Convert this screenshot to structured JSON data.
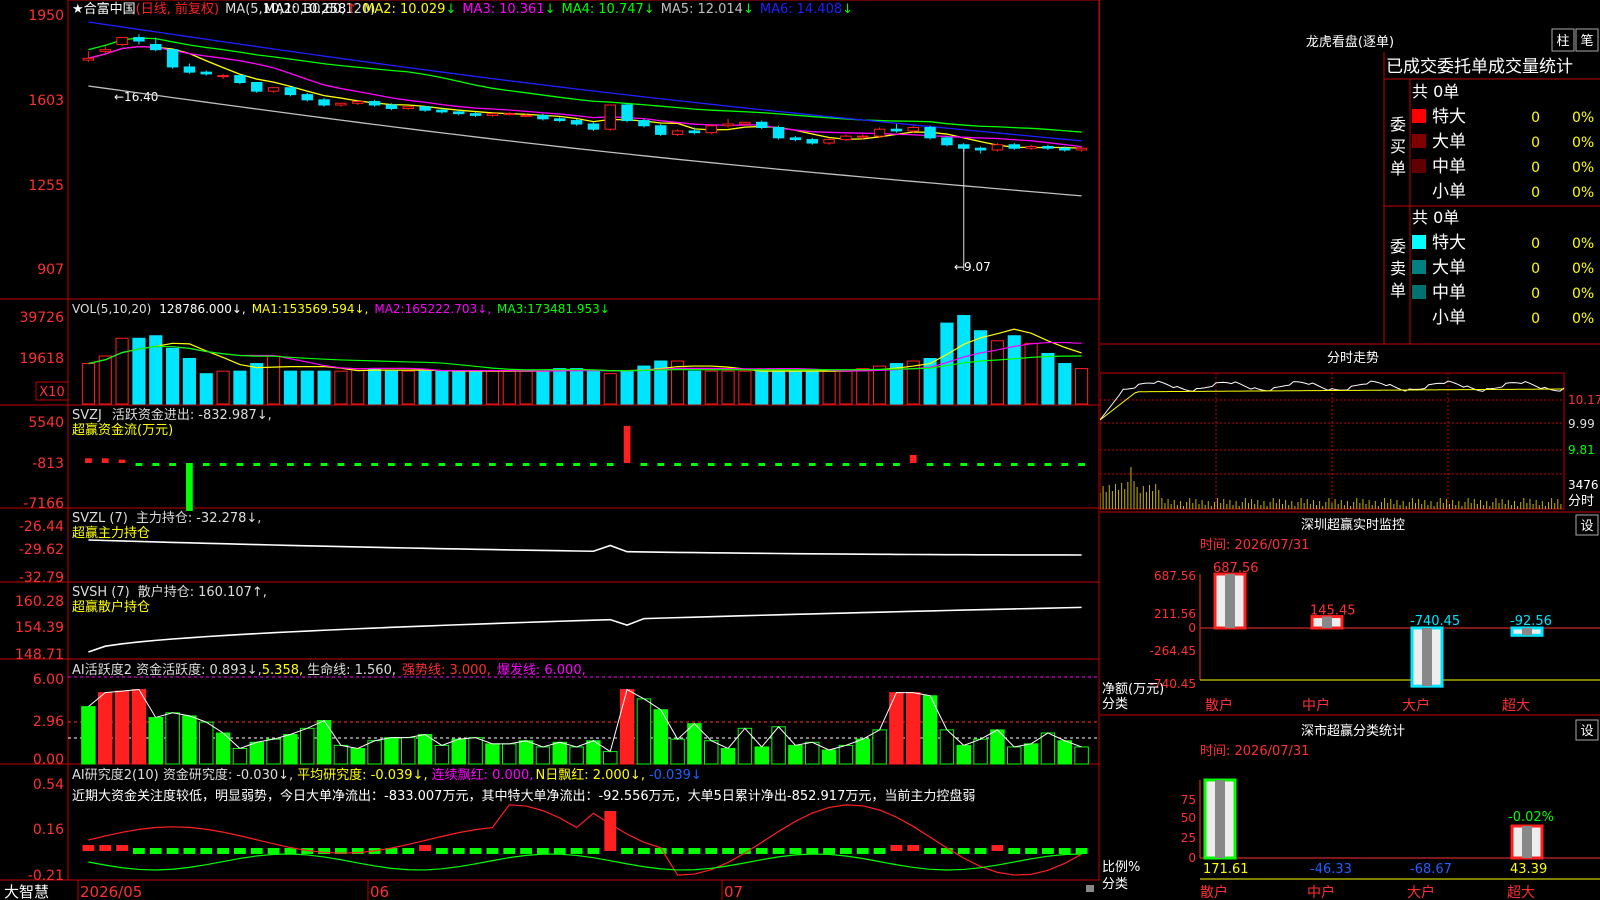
{
  "app": {
    "brand": "大智慧"
  },
  "colors": {
    "up": "#ff2020",
    "down": "#00e5ff",
    "grid": "#c00000",
    "ma1": "#ffffff",
    "ma2": "#ffff00",
    "ma3": "#ff00ff",
    "ma4": "#00ff00",
    "ma5": "#c0c0c0",
    "ma6": "#2020ff",
    "green": "#00ff00",
    "axis": "#ff3030"
  },
  "kline": {
    "star": "★",
    "stock_name": "合富中国",
    "mode": "(日线, 前复权)",
    "ma_label": "MA(5,10,20,30,60,120)",
    "ma": [
      {
        "name": "MA1:",
        "value": "10.258",
        "arrow": "↑"
      },
      {
        "name": "MA2:",
        "value": "10.029",
        "arrow": "↓"
      },
      {
        "name": "MA3:",
        "value": "10.361",
        "arrow": "↓"
      },
      {
        "name": "MA4:",
        "value": "10.747",
        "arrow": "↓"
      },
      {
        "name": "MA5:",
        "value": "12.014",
        "arrow": "↓"
      },
      {
        "name": "MA6:",
        "value": "14.408",
        "arrow": "↓"
      }
    ],
    "yticks": [
      "1950",
      "1603",
      "1255",
      "907"
    ],
    "high_label": "←16.40",
    "low_label": "←9.07"
  },
  "vol": {
    "label": "VOL(5,10,20)",
    "value": "128786.000↓,",
    "ma": [
      {
        "name": "MA1:",
        "value": "153569.594↓,"
      },
      {
        "name": "MA2:",
        "value": "165222.703↓,"
      },
      {
        "name": "MA3:",
        "value": "173481.953↓"
      }
    ],
    "yticks": [
      "39726",
      "19618"
    ],
    "unit": "X10"
  },
  "svzj": {
    "name": "SVZJ",
    "label": "活跃资金进出:",
    "value": "-832.987↓,",
    "sub": "超赢资金流(万元)",
    "yticks": [
      "5540",
      "-813",
      "-7166"
    ]
  },
  "svzl": {
    "name": "SVZL (7)",
    "label": "主力持仓:",
    "value": "-32.278↓,",
    "sub": "超赢主力持仓",
    "yticks": [
      "-26.44",
      "-29.62",
      "-32.79"
    ]
  },
  "svsh": {
    "name": "SVSH (7)",
    "label": "散户持仓:",
    "value": "160.107↑,",
    "sub": "超赢散户持仓",
    "yticks": [
      "160.28",
      "154.39",
      "148.71"
    ]
  },
  "ai_active": {
    "label": "AI活跃度2 资金活跃度:",
    "v1": "0.893↓,",
    "v2": "5.358,",
    "life": "生命线: 1.560,",
    "strong": "强势线: 3.000,",
    "burst": "爆发线: 6.000,",
    "yticks": [
      "6.00",
      "2.96",
      "0.00"
    ]
  },
  "ai_research": {
    "label": "AI研究度2(10) 资金研究度:",
    "v1": "-0.030↓,",
    "avg": "平均研究度: -0.039↓,",
    "red": "连续飘红: 0.000,",
    "nred": "N日飘红: 2.000↓,",
    "v2": "-0.039↓",
    "note": "近期大资金关注度较低，明显弱势，今日大单净流出：-833.007万元，其中特大单净流出：-92.556万元，大单5日累计净出-852.917万元，当前主力控盘弱",
    "yticks": [
      "0.54",
      "0.16",
      "-0.21"
    ]
  },
  "xaxis": [
    "2026/05",
    "06",
    "07"
  ],
  "right": {
    "lhb_title": "龙虎看盘(逐单)",
    "btn_bar": "柱",
    "btn_pen": "笔",
    "stat_title": "已成交委托单成交量统计",
    "buy_side": "委买单",
    "sell_side": "委卖单",
    "buy_total": "共 0单",
    "sell_total": "共 0单",
    "buy_rows": [
      {
        "label": "特大",
        "num": "0",
        "pct": "0%",
        "color": "#ff0000"
      },
      {
        "label": "大单",
        "num": "0",
        "pct": "0%",
        "color": "#800000"
      },
      {
        "label": "中单",
        "num": "0",
        "pct": "0%",
        "color": "#600000"
      },
      {
        "label": "小单",
        "num": "0",
        "pct": "0%",
        "color": ""
      }
    ],
    "sell_rows": [
      {
        "label": "特大",
        "num": "0",
        "pct": "0%",
        "color": "#00ffff"
      },
      {
        "label": "大单",
        "num": "0",
        "pct": "0%",
        "color": "#008080"
      },
      {
        "label": "中单",
        "num": "0",
        "pct": "0%",
        "color": "#007070"
      },
      {
        "label": "小单",
        "num": "0",
        "pct": "0%",
        "color": ""
      }
    ],
    "fs_title": "分时走势",
    "fs_yticks": [
      "10.17",
      "9.99",
      "9.81"
    ],
    "fs_vol": "3476",
    "fs_label": "分时",
    "sz_title": "深圳超赢实时监控",
    "set": "设",
    "time_label": "时间: 2026/07/31",
    "sz_yticks": [
      "687.56",
      "211.56",
      "0",
      "-264.45",
      "-740.45"
    ],
    "sz_net": "净额(万元)",
    "sz_cat": "分类",
    "categories": [
      "散户",
      "中户",
      "大户",
      "超大"
    ],
    "sz_values": [
      "687.56",
      "145.45",
      "-740.45",
      "-92.56"
    ],
    "cls_title": "深市超赢分类统计",
    "cls_yticks": [
      "75",
      "50",
      "25",
      "0"
    ],
    "cls_ratio": "比例%",
    "cls_values": [
      "171.61",
      "-46.33",
      "-68.67",
      "43.39"
    ],
    "cls_top": "-0.02%"
  },
  "chart_data": [
    {
      "type": "candlestick",
      "title": "合富中国 (日线, 前复权)",
      "candles": [
        [
          15.65,
          15.9,
          15.7,
          15.6
        ],
        [
          15.9,
          16.05,
          15.95,
          15.85
        ],
        [
          16.1,
          16.2,
          16.3,
          16.05
        ],
        [
          16.3,
          16.4,
          16.2,
          16.1
        ],
        [
          16.1,
          16.3,
          15.95,
          15.9
        ],
        [
          15.95,
          15.95,
          15.45,
          15.4
        ],
        [
          15.45,
          15.55,
          15.3,
          15.25
        ],
        [
          15.3,
          15.35,
          15.25,
          15.2
        ],
        [
          15.2,
          15.25,
          15.2,
          15.1
        ],
        [
          15.2,
          15.2,
          15.0,
          14.95
        ],
        [
          15.0,
          15.0,
          14.75,
          14.7
        ],
        [
          14.75,
          14.85,
          14.85,
          14.7
        ],
        [
          14.85,
          14.85,
          14.65,
          14.6
        ],
        [
          14.65,
          14.7,
          14.5,
          14.45
        ],
        [
          14.5,
          14.55,
          14.35,
          14.3
        ],
        [
          14.35,
          14.4,
          14.4,
          14.3
        ],
        [
          14.4,
          14.45,
          14.45,
          14.35
        ],
        [
          14.45,
          14.5,
          14.35,
          14.3
        ],
        [
          14.35,
          14.4,
          14.25,
          14.2
        ],
        [
          14.25,
          14.3,
          14.3,
          14.2
        ],
        [
          14.3,
          14.3,
          14.2,
          14.15
        ],
        [
          14.2,
          14.25,
          14.15,
          14.1
        ],
        [
          14.15,
          14.2,
          14.1,
          14.05
        ],
        [
          14.1,
          14.15,
          14.05,
          14.0
        ],
        [
          14.05,
          14.1,
          14.1,
          14.0
        ],
        [
          14.1,
          14.15,
          14.1,
          14.05
        ],
        [
          14.05,
          14.1,
          14.05,
          14.0
        ],
        [
          14.05,
          14.1,
          13.95,
          13.9
        ],
        [
          13.95,
          14.0,
          13.9,
          13.85
        ],
        [
          13.9,
          13.95,
          13.8,
          13.75
        ],
        [
          13.8,
          13.85,
          13.65,
          13.6
        ],
        [
          13.65,
          14.35,
          14.35,
          13.6
        ],
        [
          14.35,
          14.4,
          13.9,
          13.85
        ],
        [
          13.9,
          13.95,
          13.75,
          13.7
        ],
        [
          13.75,
          13.8,
          13.5,
          13.45
        ],
        [
          13.5,
          13.65,
          13.6,
          13.45
        ],
        [
          13.6,
          13.7,
          13.55,
          13.5
        ],
        [
          13.55,
          13.75,
          13.75,
          13.5
        ],
        [
          13.75,
          13.95,
          13.8,
          13.7
        ],
        [
          13.8,
          13.85,
          13.85,
          13.75
        ],
        [
          13.85,
          13.9,
          13.7,
          13.65
        ],
        [
          13.7,
          13.75,
          13.4,
          13.35
        ],
        [
          13.4,
          13.45,
          13.35,
          13.3
        ],
        [
          13.35,
          13.4,
          13.25,
          13.2
        ],
        [
          13.25,
          13.4,
          13.35,
          13.2
        ],
        [
          13.35,
          13.5,
          13.45,
          13.3
        ],
        [
          13.45,
          13.5,
          13.45,
          13.35
        ],
        [
          13.45,
          13.7,
          13.65,
          13.4
        ],
        [
          13.65,
          13.8,
          13.6,
          13.55
        ],
        [
          13.6,
          13.75,
          13.7,
          13.55
        ],
        [
          13.7,
          13.75,
          13.4,
          13.35
        ],
        [
          13.4,
          13.45,
          13.2,
          13.15
        ],
        [
          13.2,
          13.25,
          13.1,
          9.07
        ],
        [
          13.1,
          13.15,
          13.05,
          12.95
        ],
        [
          13.05,
          13.25,
          13.2,
          13.0
        ],
        [
          13.2,
          13.25,
          13.1,
          13.05
        ],
        [
          13.1,
          13.2,
          13.15,
          13.05
        ],
        [
          13.15,
          13.2,
          13.1,
          13.05
        ],
        [
          13.1,
          13.15,
          13.05,
          13.0
        ],
        [
          13.05,
          13.15,
          13.1,
          13.0
        ]
      ],
      "ylim": [
        9.07,
        16.4
      ],
      "note": "OHLC values approximated; y tick labels shown: 1950, 1603, 1255, 907"
    },
    {
      "type": "bar",
      "title": "VOL(5,10,20)",
      "values": [
        16,
        19,
        26,
        26,
        27,
        22,
        18,
        12,
        13,
        13,
        16,
        19,
        13,
        13,
        13,
        13,
        14,
        14,
        13,
        13,
        13,
        13,
        13,
        13,
        13,
        13,
        13,
        13,
        14,
        14,
        13,
        12,
        13,
        15,
        17,
        17,
        13,
        13,
        13,
        13,
        13,
        13,
        13,
        13,
        13,
        13,
        14,
        15,
        16,
        17,
        18,
        32,
        35,
        29,
        25,
        27,
        24,
        20,
        16,
        14,
        15,
        16,
        16
      ]
    },
    {
      "type": "bar",
      "title": "SVZJ",
      "values": [
        700,
        700,
        500,
        -200,
        -300,
        -400,
        -7166,
        -300,
        -200,
        -400,
        -300,
        -300,
        -400,
        -300,
        -300,
        -300,
        -300,
        -200,
        -300,
        -300,
        -300,
        -200,
        -300,
        -300,
        -200,
        -300,
        -200,
        -300,
        -200,
        -300,
        -300,
        -300,
        5540,
        -300,
        -300,
        -200,
        -300,
        -300,
        -200,
        -300,
        -200,
        -300,
        -200,
        -300,
        -200,
        -300,
        -200,
        -300,
        -200,
        1200,
        -300,
        -300,
        -200,
        -300,
        -200,
        -300,
        -200,
        -300,
        -200,
        -200,
        -300,
        -200,
        -300
      ]
    },
    {
      "type": "bar",
      "title": "AI活跃度2",
      "values": [
        3.7,
        4.6,
        4.7,
        4.8,
        3.0,
        3.3,
        3.1,
        2.7,
        2.0,
        1.0,
        1.4,
        1.6,
        1.9,
        2.3,
        2.8,
        1.2,
        1.0,
        1.5,
        1.7,
        1.7,
        1.9,
        1.2,
        1.6,
        1.7,
        1.3,
        1.3,
        1.5,
        1.1,
        1.4,
        1.1,
        1.5,
        0.8,
        4.8,
        4.2,
        3.5,
        1.6,
        2.6,
        1.5,
        1.0,
        2.3,
        1.1,
        2.4,
        1.2,
        1.4,
        0.9,
        1.2,
        1.6,
        2.2,
        4.6,
        4.6,
        4.4,
        2.2,
        1.2,
        1.6,
        2.2,
        1.1,
        1.3,
        2.0,
        1.5,
        1.1,
        1.0,
        0.9
      ]
    }
  ]
}
